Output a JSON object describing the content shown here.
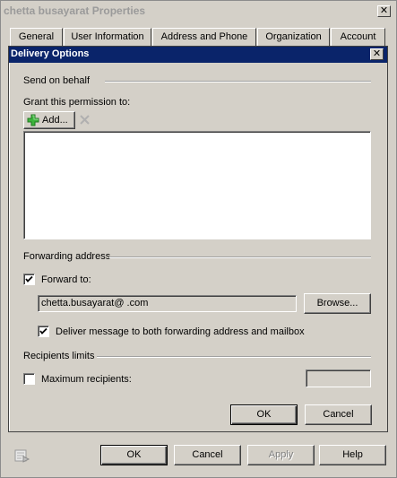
{
  "window": {
    "title": "chetta busayarat Properties",
    "close_glyph": "✕"
  },
  "tabs": [
    {
      "label": "General"
    },
    {
      "label": "User Information"
    },
    {
      "label": "Address and Phone"
    },
    {
      "label": "Organization"
    },
    {
      "label": "Account"
    }
  ],
  "dialog": {
    "title": "Delivery Options",
    "close_glyph": "✕",
    "send_on_behalf": {
      "group_label": "Send on behalf",
      "grant_label": "Grant this permission to:",
      "add_button": "Add...",
      "remove_icon": "remove-x-icon",
      "grantees": []
    },
    "forwarding": {
      "group_label": "Forwarding address",
      "forward_to_label": "Forward to:",
      "forward_to_checked": true,
      "forward_address": "chetta.busayarat@            .com",
      "browse_button": "Browse...",
      "deliver_both_label": "Deliver message to both forwarding address and mailbox",
      "deliver_both_checked": true
    },
    "recipients": {
      "group_label": "Recipients limits",
      "max_label": "Maximum recipients:",
      "max_checked": false,
      "max_value": ""
    },
    "ok_button": "OK",
    "cancel_button": "Cancel"
  },
  "footer": {
    "ok_button": "OK",
    "cancel_button": "Cancel",
    "apply_button": "Apply",
    "help_button": "Help",
    "apply_enabled": false
  }
}
